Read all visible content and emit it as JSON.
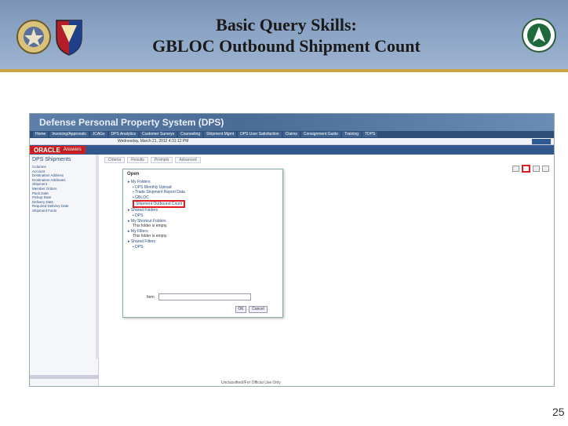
{
  "slide": {
    "title_line1": "Basic Query Skills:",
    "title_line2": "GBLOC Outbound Shipment Count",
    "page_number": "25"
  },
  "app": {
    "title": "Defense Personal Property System (DPS)",
    "nav_tabs": [
      "Home",
      "Invoicing/Approvals",
      "JCAGs",
      "DPS Analytics",
      "Customer Surveys",
      "Counseling",
      "Shipment Mgmt",
      "DPS User Satisfaction",
      "Claims",
      "Consignment Guide",
      "Training",
      "TDPS"
    ],
    "date_text": "Wednesday, March 21, 2012 4:31:12 PM",
    "oracle_logo": "ORACLE",
    "oracle_product": "Answers",
    "left_pane": {
      "title": "DPS Shipments",
      "items": [
        "Columns",
        "Account",
        "Destination Address",
        "Destination Attributes",
        "Shipment",
        "Member Orders",
        "Pack Date",
        "Pickup Date",
        "Delivery Date",
        "Required Delivery Date",
        "Shipment Facts"
      ]
    },
    "right_pane": {
      "tabs": [
        "Criteria",
        "Results",
        "Prompts",
        "Advanced"
      ]
    },
    "footer": "Unclassified//For Official Use Only"
  },
  "dialog": {
    "title": "Open",
    "tree": [
      {
        "text": "My Folders",
        "depth": 0
      },
      {
        "text": "DPS Monthly Upload",
        "depth": 1
      },
      {
        "text": "Trade Shipment Report Data",
        "depth": 1
      },
      {
        "text": "GBLOC",
        "depth": 1
      },
      {
        "text": "Shipment Outbound Count",
        "depth": 1,
        "selected": true
      },
      {
        "text": "Shared Folders",
        "depth": 0
      },
      {
        "text": "DPS",
        "depth": 1
      },
      {
        "text": "My Shortcut Folders",
        "depth": 0
      },
      {
        "text": "This folder is empty.",
        "depth": 1,
        "plain": true
      },
      {
        "text": "My Filters",
        "depth": 0
      },
      {
        "text": "This folder is empty.",
        "depth": 1,
        "plain": true
      },
      {
        "text": "Shared Filters",
        "depth": 0
      },
      {
        "text": "DPS",
        "depth": 1
      }
    ],
    "name_label": "Item",
    "ok": "OK",
    "cancel": "Cancel"
  }
}
